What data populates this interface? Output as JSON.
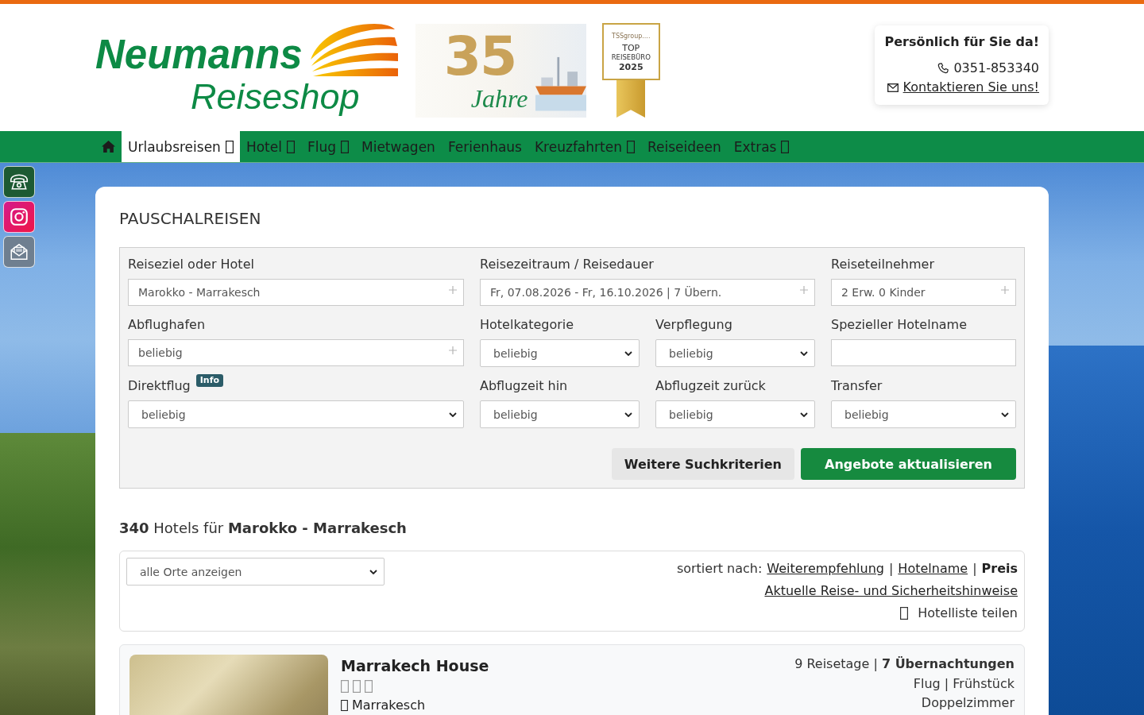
{
  "header": {
    "logo": {
      "wordmark": "Neumanns",
      "subtitle": "Reiseshop"
    },
    "anniversary": {
      "number": "35",
      "word": "Jahre"
    },
    "award": {
      "brand": "TSSgroup....",
      "line_1": "TOP",
      "line_2": "REISEBÜRO",
      "year": "2025"
    },
    "contact": {
      "title": "Persönlich für Sie da!",
      "phone": "0351-853340",
      "link": "Kontaktieren Sie uns!"
    }
  },
  "nav": {
    "items": [
      {
        "kind": "home",
        "selected": false
      },
      {
        "kind": "link",
        "label": "Urlaubsreisen",
        "dropdown": true,
        "selected": true
      },
      {
        "kind": "link",
        "label": "Hotel",
        "dropdown": true,
        "selected": false
      },
      {
        "kind": "link",
        "label": "Flug",
        "dropdown": true,
        "selected": false
      },
      {
        "kind": "link",
        "label": "Mietwagen",
        "dropdown": false,
        "selected": false
      },
      {
        "kind": "link",
        "label": "Ferienhaus",
        "dropdown": false,
        "selected": false
      },
      {
        "kind": "link",
        "label": "Kreuzfahrten",
        "dropdown": true,
        "selected": false
      },
      {
        "kind": "link",
        "label": "Reiseideen",
        "dropdown": false,
        "selected": false
      },
      {
        "kind": "link",
        "label": "Extras",
        "dropdown": true,
        "selected": false
      }
    ]
  },
  "side_buttons": [
    {
      "kind": "phone"
    },
    {
      "kind": "camera"
    },
    {
      "kind": "mail"
    }
  ],
  "search": {
    "title": "PAUSCHALREISEN",
    "fields": [
      {
        "label": "Reiseziel oder Hotel",
        "kind": "picker",
        "value": "Marokko - Marrakesch"
      },
      {
        "label": "Reisezeitraum / Reisedauer",
        "kind": "picker",
        "wide": true,
        "value": "Fr, 07.08.2026 - Fr, 16.10.2026 | 7 Übern."
      },
      {
        "label": "Reiseteilnehmer",
        "kind": "picker",
        "value": "2 Erw. 0 Kinder"
      },
      {
        "label": "Abflughafen",
        "kind": "picker",
        "value": "beliebig"
      },
      {
        "label": "Hotelkategorie",
        "kind": "select",
        "value": "beliebig"
      },
      {
        "label": "Verpflegung",
        "kind": "select",
        "value": "beliebig"
      },
      {
        "label": "Spezieller Hotelname",
        "kind": "text"
      },
      {
        "label": "Direktflug",
        "badge": "Info",
        "kind": "select",
        "value": "beliebig"
      },
      {
        "label": "Abflugzeit hin",
        "kind": "select",
        "value": "beliebig"
      },
      {
        "label": "Abflugzeit zurück",
        "kind": "select",
        "value": "beliebig"
      },
      {
        "label": "Transfer",
        "kind": "select",
        "value": "beliebig"
      }
    ],
    "buttons": [
      {
        "label": "Weitere Suchkriterien",
        "kind": "secondary"
      },
      {
        "label": "Angebote aktualisieren",
        "kind": "primary"
      }
    ]
  },
  "results": {
    "summary": "**340** Hotels für **Marokko - Marrakesch**",
    "location_filter": "alle Orte anzeigen",
    "sort_label": "sortiert nach:",
    "sort_separator": "|",
    "sort_options": [
      {
        "label": "Weiterempfehlung",
        "selected": false
      },
      {
        "label": "Hotelname",
        "selected": false
      },
      {
        "label": "Preis",
        "selected": true
      }
    ],
    "notice_link": "Aktuelle Reise- und Sicherheitshinweise",
    "share": "Hotelliste teilen"
  },
  "hotels": [
    {
      "name": "Marrakech House",
      "category_marks": [
        {
          "kind": "glyph_box"
        },
        {
          "kind": "glyph_box"
        },
        {
          "kind": "glyph_box"
        }
      ],
      "location": "Marrakesch",
      "duration": "9 Reisetage | **7 Übernachtungen**",
      "travel": "Flug | Frühstück",
      "room": "Doppelzimmer"
    }
  ]
}
